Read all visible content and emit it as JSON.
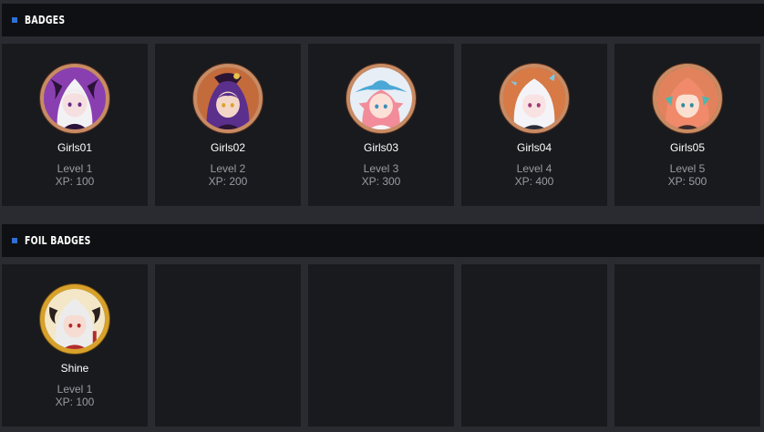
{
  "badges_section": {
    "title": "BADGES",
    "accent_color": "#2f6fd6",
    "items": [
      {
        "name": "Girls01",
        "level": "Level 1",
        "xp": "XP: 100",
        "icon": "girls01-avatar-icon",
        "palette": {
          "bg": "#8a3fb0",
          "hair": "#f2f2f4",
          "skin": "#f6dfe0",
          "accent": "#2a1238"
        }
      },
      {
        "name": "Girls02",
        "level": "Level 2",
        "xp": "XP: 200",
        "icon": "girls02-avatar-icon",
        "palette": {
          "bg": "#c46b3c",
          "hair": "#5b2f8c",
          "skin": "#f4d6c8",
          "accent": "#2c1533"
        }
      },
      {
        "name": "Girls03",
        "level": "Level 3",
        "xp": "XP: 300",
        "icon": "girls03-avatar-icon",
        "palette": {
          "bg": "#e8eef6",
          "hair": "#f28c9a",
          "skin": "#fbe1d8",
          "accent": "#4aa7d6"
        }
      },
      {
        "name": "Girls04",
        "level": "Level 4",
        "xp": "XP: 400",
        "icon": "girls04-avatar-icon",
        "palette": {
          "bg": "#d77a45",
          "hair": "#f4f4f8",
          "skin": "#f8e2e2",
          "accent": "#7ec6e6"
        }
      },
      {
        "name": "Girls05",
        "level": "Level 5",
        "xp": "XP: 500",
        "icon": "girls05-avatar-icon",
        "palette": {
          "bg": "#e1825c",
          "hair": "#f08a6b",
          "skin": "#fbe0d2",
          "accent": "#4fb6b0"
        }
      }
    ]
  },
  "foil_section": {
    "title": "FOIL BADGES",
    "accent_color": "#2f6fd6",
    "items": [
      {
        "name": "Shine",
        "level": "Level 1",
        "xp": "XP: 100",
        "icon": "shine-foil-avatar-icon",
        "palette": {
          "bg": "#f3e7c8",
          "hair": "#ececec",
          "skin": "#f6dcd2",
          "accent": "#b32b2b"
        }
      }
    ],
    "empty_slots": 4
  },
  "colors": {
    "page_bg": "#2a2b30",
    "header_bg": "#0f1013",
    "card_bg": "#191a1e",
    "name_text": "#ffffff",
    "meta_text": "#9a9ba0"
  }
}
